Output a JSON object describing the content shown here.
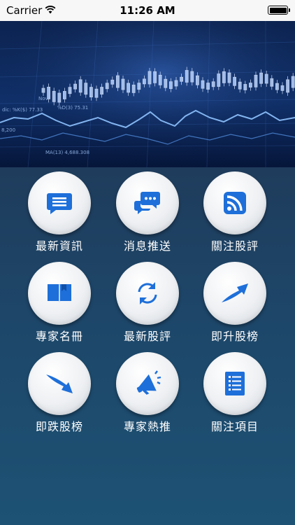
{
  "status_bar": {
    "carrier": "Carrier",
    "time": "11:26 AM",
    "battery_level": 1.0
  },
  "banner": {
    "description_icon": "stock-chart-image",
    "texts": {
      "nov": "Nov",
      "dic": "dic: %K($) 77.33",
      "pct": "%D(3) 75.31",
      "ma": "MA(13) 4,688.308",
      "left": "8,200"
    }
  },
  "menu": {
    "accent_color": "#1e6fd9",
    "items": [
      {
        "label": "最新資訊",
        "icon": "news-message-icon"
      },
      {
        "label": "消息推送",
        "icon": "chat-push-icon"
      },
      {
        "label": "關注股評",
        "icon": "rss-feed-icon"
      },
      {
        "label": "專家名冊",
        "icon": "book-icon"
      },
      {
        "label": "最新股評",
        "icon": "refresh-icon"
      },
      {
        "label": "即升股榜",
        "icon": "up-arrow-icon"
      },
      {
        "label": "即跌股榜",
        "icon": "down-arrow-icon"
      },
      {
        "label": "專家熱推",
        "icon": "megaphone-icon"
      },
      {
        "label": "關注項目",
        "icon": "list-icon"
      }
    ]
  }
}
